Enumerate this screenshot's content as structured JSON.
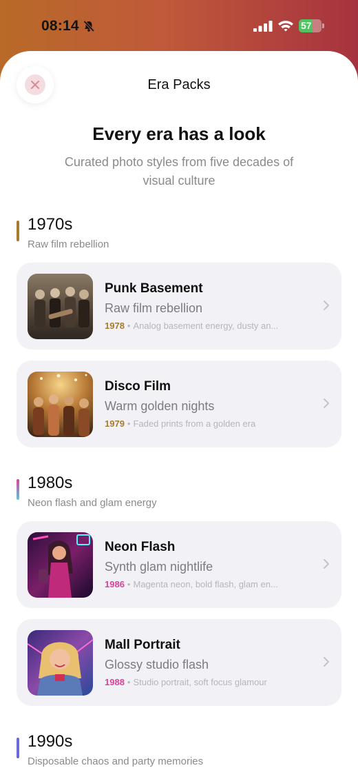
{
  "status": {
    "time": "08:14",
    "battery": "57"
  },
  "sheet": {
    "title": "Era Packs",
    "headline": "Every era has a look",
    "subtitle": "Curated photo styles from five decades of visual culture"
  },
  "colors": {
    "seventies_accent": "#a87a2c",
    "eighties_accent": "#e0409a",
    "nineties_accent": "#6a6ad8"
  },
  "sections": [
    {
      "title": "1970s",
      "subtitle": "Raw film rebellion",
      "cards": [
        {
          "title": "Punk Basement",
          "tagline": "Raw film rebellion",
          "year": "1978",
          "desc": "Analog basement energy, dusty an..."
        },
        {
          "title": "Disco Film",
          "tagline": "Warm golden nights",
          "year": "1979",
          "desc": "Faded prints from a golden era"
        }
      ]
    },
    {
      "title": "1980s",
      "subtitle": "Neon flash and glam energy",
      "cards": [
        {
          "title": "Neon Flash",
          "tagline": "Synth glam nightlife",
          "year": "1986",
          "desc": "Magenta neon, bold flash, glam en..."
        },
        {
          "title": "Mall Portrait",
          "tagline": "Glossy studio flash",
          "year": "1988",
          "desc": "Studio portrait, soft focus glamour"
        }
      ]
    },
    {
      "title": "1990s",
      "subtitle": "Disposable chaos and party memories"
    }
  ]
}
